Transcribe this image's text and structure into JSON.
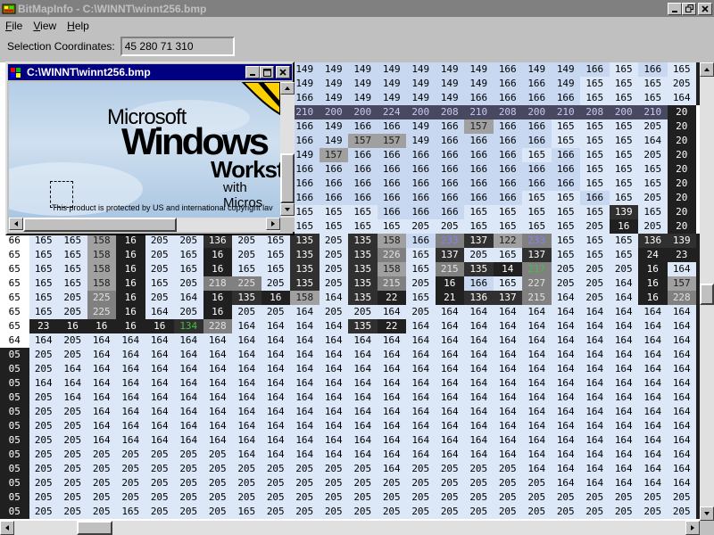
{
  "window": {
    "title": "BitMapInfo - C:\\WINNT\\winnt256.bmp"
  },
  "menu": [
    {
      "key": "F",
      "rest": "ile"
    },
    {
      "key": "V",
      "rest": "iew"
    },
    {
      "key": "H",
      "rest": "elp"
    }
  ],
  "selection": {
    "label": "Selection Coordinates:",
    "value": "45 280 71 310"
  },
  "child_window": {
    "title": "C:\\WINNT\\winnt256.bmp",
    "microsoft": "Microsoft",
    "windows": "Windows",
    "workst": "Workst",
    "with_micros": "with Micros",
    "copyright": "This product is protected by US and international copyright lav"
  },
  "grid": {
    "colors": {
      "light": "#c8d8f0",
      "lighter": "#dce8f8",
      "dark": "#202020",
      "mid": "#808080",
      "lavender": "#c8c8f0",
      "hi_bar": "#484860"
    },
    "rows": [
      [
        "",
        "",
        "",
        "",
        "",
        "",
        "",
        "",
        "",
        "",
        "149",
        "149",
        "149",
        "149",
        "149",
        "149",
        "149",
        "166",
        "149",
        "149",
        "166",
        "165",
        "166",
        "165",
        "16"
      ],
      [
        "",
        "",
        "",
        "",
        "",
        "",
        "",
        "",
        "",
        "",
        "149",
        "149",
        "149",
        "149",
        "149",
        "149",
        "149",
        "166",
        "166",
        "149",
        "165",
        "165",
        "165",
        "205",
        "20"
      ],
      [
        "",
        "",
        "",
        "",
        "",
        "",
        "",
        "",
        "",
        "",
        "166",
        "149",
        "149",
        "149",
        "149",
        "149",
        "166",
        "166",
        "166",
        "166",
        "165",
        "165",
        "165",
        "164",
        "20"
      ],
      [
        "",
        "",
        "",
        "",
        "",
        "",
        "",
        "",
        "",
        "",
        "210",
        "200",
        "200",
        "224",
        "200",
        "208",
        "210",
        "208",
        "200",
        "210",
        "208",
        "200",
        "210",
        "20",
        ""
      ],
      [
        "",
        "",
        "",
        "",
        "",
        "",
        "",
        "",
        "",
        "",
        "166",
        "149",
        "166",
        "166",
        "149",
        "166",
        "157",
        "166",
        "166",
        "165",
        "165",
        "165",
        "205",
        "20",
        ""
      ],
      [
        "",
        "",
        "",
        "",
        "",
        "",
        "",
        "",
        "",
        "",
        "166",
        "149",
        "157",
        "157",
        "149",
        "166",
        "166",
        "166",
        "166",
        "165",
        "165",
        "165",
        "164",
        "20",
        ""
      ],
      [
        "",
        "",
        "",
        "",
        "",
        "",
        "",
        "",
        "",
        "",
        "149",
        "157",
        "166",
        "166",
        "166",
        "166",
        "166",
        "166",
        "165",
        "166",
        "165",
        "165",
        "205",
        "20",
        ""
      ],
      [
        "",
        "",
        "",
        "",
        "",
        "",
        "",
        "",
        "",
        "",
        "166",
        "166",
        "166",
        "166",
        "166",
        "166",
        "166",
        "166",
        "166",
        "166",
        "165",
        "165",
        "165",
        "20",
        ""
      ],
      [
        "",
        "",
        "",
        "",
        "",
        "",
        "",
        "",
        "",
        "",
        "166",
        "166",
        "166",
        "166",
        "166",
        "166",
        "166",
        "166",
        "166",
        "166",
        "165",
        "165",
        "165",
        "20",
        ""
      ],
      [
        "",
        "",
        "",
        "",
        "",
        "",
        "",
        "",
        "",
        "",
        "166",
        "166",
        "166",
        "166",
        "166",
        "166",
        "166",
        "166",
        "165",
        "165",
        "166",
        "165",
        "205",
        "20",
        ""
      ],
      [
        "",
        "",
        "",
        "",
        "",
        "",
        "",
        "",
        "",
        "",
        "165",
        "165",
        "165",
        "166",
        "166",
        "166",
        "165",
        "165",
        "165",
        "165",
        "165",
        "139",
        "165",
        "20",
        ""
      ],
      [
        "",
        "",
        "",
        "",
        "",
        "",
        "",
        "",
        "",
        "",
        "165",
        "165",
        "165",
        "165",
        "205",
        "205",
        "165",
        "165",
        "165",
        "165",
        "205",
        "16",
        "205",
        "20",
        ""
      ],
      [
        "66",
        "165",
        "165",
        "158",
        "16",
        "205",
        "205",
        "136",
        "205",
        "165",
        "135",
        "205",
        "135",
        "158",
        "166",
        "233",
        "137",
        "122",
        "233",
        "165",
        "165",
        "165",
        "136",
        "139",
        "15"
      ],
      [
        "65",
        "165",
        "165",
        "158",
        "16",
        "205",
        "165",
        "16",
        "205",
        "165",
        "135",
        "205",
        "135",
        "226",
        "165",
        "137",
        "205",
        "165",
        "137",
        "165",
        "165",
        "165",
        "24",
        "23",
        "16"
      ],
      [
        "65",
        "165",
        "165",
        "158",
        "16",
        "205",
        "165",
        "16",
        "165",
        "165",
        "135",
        "205",
        "135",
        "158",
        "165",
        "215",
        "135",
        "14",
        "217",
        "205",
        "205",
        "205",
        "16",
        "164",
        "20"
      ],
      [
        "65",
        "165",
        "165",
        "158",
        "16",
        "165",
        "205",
        "218",
        "225",
        "205",
        "135",
        "205",
        "135",
        "215",
        "205",
        "16",
        "166",
        "165",
        "227",
        "205",
        "205",
        "164",
        "16",
        "157",
        "16"
      ],
      [
        "65",
        "165",
        "205",
        "225",
        "16",
        "205",
        "164",
        "16",
        "135",
        "16",
        "158",
        "164",
        "135",
        "22",
        "165",
        "21",
        "136",
        "137",
        "215",
        "164",
        "205",
        "164",
        "16",
        "228",
        "15"
      ],
      [
        "65",
        "165",
        "205",
        "225",
        "16",
        "164",
        "205",
        "16",
        "205",
        "205",
        "164",
        "205",
        "205",
        "164",
        "205",
        "164",
        "164",
        "164",
        "164",
        "164",
        "164",
        "164",
        "164",
        "164",
        "16"
      ],
      [
        "65",
        "23",
        "16",
        "16",
        "16",
        "16",
        "134",
        "228",
        "164",
        "164",
        "164",
        "164",
        "135",
        "22",
        "164",
        "164",
        "164",
        "164",
        "164",
        "164",
        "164",
        "164",
        "164",
        "164",
        "16"
      ],
      [
        "64",
        "164",
        "205",
        "164",
        "164",
        "164",
        "164",
        "164",
        "164",
        "164",
        "164",
        "164",
        "164",
        "164",
        "164",
        "164",
        "164",
        "164",
        "164",
        "164",
        "164",
        "164",
        "164",
        "164",
        "16"
      ],
      [
        "05",
        "205",
        "205",
        "164",
        "164",
        "164",
        "164",
        "164",
        "164",
        "164",
        "164",
        "164",
        "164",
        "164",
        "164",
        "164",
        "164",
        "164",
        "164",
        "164",
        "164",
        "164",
        "164",
        "164",
        "16"
      ],
      [
        "05",
        "205",
        "164",
        "164",
        "164",
        "164",
        "164",
        "164",
        "164",
        "164",
        "164",
        "164",
        "164",
        "164",
        "164",
        "164",
        "164",
        "164",
        "164",
        "164",
        "164",
        "164",
        "164",
        "164",
        "16"
      ],
      [
        "05",
        "164",
        "164",
        "164",
        "164",
        "164",
        "164",
        "164",
        "164",
        "164",
        "164",
        "164",
        "164",
        "164",
        "164",
        "164",
        "164",
        "164",
        "164",
        "164",
        "164",
        "164",
        "164",
        "164",
        "16"
      ],
      [
        "05",
        "205",
        "164",
        "164",
        "164",
        "164",
        "164",
        "164",
        "164",
        "164",
        "164",
        "164",
        "164",
        "164",
        "164",
        "164",
        "164",
        "164",
        "164",
        "164",
        "164",
        "164",
        "164",
        "164",
        "16"
      ],
      [
        "05",
        "205",
        "205",
        "164",
        "164",
        "164",
        "164",
        "164",
        "164",
        "164",
        "164",
        "164",
        "164",
        "164",
        "164",
        "164",
        "164",
        "164",
        "164",
        "164",
        "164",
        "164",
        "164",
        "164",
        "16"
      ],
      [
        "05",
        "205",
        "205",
        "164",
        "164",
        "164",
        "164",
        "164",
        "164",
        "164",
        "164",
        "164",
        "164",
        "164",
        "164",
        "164",
        "164",
        "164",
        "164",
        "164",
        "164",
        "164",
        "164",
        "164",
        "16"
      ],
      [
        "05",
        "205",
        "205",
        "164",
        "164",
        "164",
        "164",
        "164",
        "164",
        "164",
        "164",
        "164",
        "164",
        "164",
        "164",
        "164",
        "164",
        "164",
        "164",
        "164",
        "164",
        "164",
        "164",
        "164",
        "16"
      ],
      [
        "05",
        "205",
        "205",
        "205",
        "205",
        "205",
        "205",
        "205",
        "164",
        "164",
        "164",
        "164",
        "164",
        "164",
        "164",
        "164",
        "164",
        "164",
        "164",
        "164",
        "164",
        "164",
        "164",
        "164",
        "16"
      ],
      [
        "05",
        "205",
        "205",
        "205",
        "205",
        "205",
        "205",
        "205",
        "205",
        "205",
        "205",
        "205",
        "205",
        "164",
        "205",
        "205",
        "205",
        "205",
        "164",
        "164",
        "164",
        "164",
        "164",
        "164",
        "16"
      ],
      [
        "05",
        "205",
        "205",
        "205",
        "205",
        "205",
        "205",
        "205",
        "205",
        "205",
        "205",
        "205",
        "205",
        "205",
        "205",
        "205",
        "205",
        "205",
        "205",
        "164",
        "164",
        "164",
        "164",
        "164",
        "16"
      ],
      [
        "05",
        "205",
        "205",
        "205",
        "205",
        "205",
        "205",
        "205",
        "205",
        "205",
        "205",
        "205",
        "205",
        "205",
        "205",
        "205",
        "205",
        "205",
        "205",
        "205",
        "205",
        "205",
        "205",
        "205",
        "20"
      ],
      [
        "05",
        "205",
        "205",
        "205",
        "165",
        "205",
        "205",
        "205",
        "165",
        "205",
        "205",
        "205",
        "205",
        "205",
        "205",
        "205",
        "205",
        "205",
        "205",
        "205",
        "205",
        "205",
        "205",
        "205",
        "20"
      ]
    ]
  }
}
